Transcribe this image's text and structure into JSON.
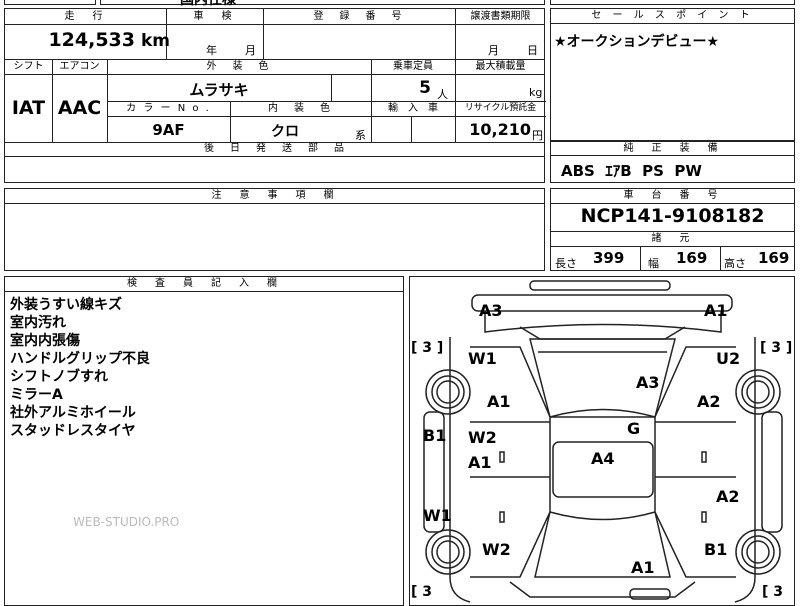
{
  "top_strip": {
    "title": "国内仕様"
  },
  "mileage": {
    "header": "走　行",
    "value": "124,533",
    "unit": "km"
  },
  "inspection": {
    "header": "車　検",
    "year_label": "年",
    "month_label": "月"
  },
  "registration": {
    "header": "登　録　番　号"
  },
  "transfer": {
    "header": "譲渡書類期限",
    "month_label": "月",
    "day_label": "日"
  },
  "vehicle": {
    "shift_label": "シフト",
    "aircon_label": "エアコン",
    "shift": "IAT",
    "aircon": "AAC",
    "exterior_label": "外　装　色",
    "exterior": "ムラサキ",
    "capacity_label": "乗車定員",
    "capacity": "5",
    "capacity_unit": "人",
    "maxload_label": "最大積載量",
    "maxload_unit": "kg",
    "color_no_label": "カ ラ ー N o .",
    "color_no": "9AF",
    "interior_label": "内　装　色",
    "interior": "クロ",
    "interior_suffix": "系",
    "import_label": "輸　入　車",
    "recycle_label": "リサイクル預託金",
    "recycle": "10,210",
    "recycle_unit": "円",
    "later_parts_label": "後　日　発　送　部　品"
  },
  "sales_point": {
    "header": "セ ー ル ス ポ イ ン ト",
    "text": "★オークションデビュー★"
  },
  "equipment": {
    "header": "純　正　装　備",
    "text": "ABS  ｴｱB  PS  PW"
  },
  "caution": {
    "header": "注　意　事　項　欄"
  },
  "chassis": {
    "header": "車　台　番　号",
    "value": "NCP141-9108182"
  },
  "specs": {
    "header": "諸　元",
    "length_label": "長さ",
    "length": "399",
    "width_label": "幅",
    "width": "169",
    "height_label": "高さ",
    "height": "169"
  },
  "inspector": {
    "header": "検　査　員　記　入　欄",
    "notes": [
      "外装うすい線キズ",
      "室内汚れ",
      "室内内張傷",
      "ハンドルグリップ不良",
      "シフトノブすれ",
      "ミラーA",
      "社外アルミホイール",
      "スタッドレスタイヤ"
    ]
  },
  "watermark": "WEB-STUDIO.PRO",
  "diagram": {
    "tire_tl": "[ 3 ]",
    "tire_tr": "[ 3 ]",
    "tire_bl": "[ 3",
    "tire_br": "[ 3",
    "labels": {
      "a3_top": "A3",
      "a1_top": "A1",
      "w1_l": "W1",
      "u2_r": "U2",
      "a3_mid": "A3",
      "a1_lf": "A1",
      "a2_rf": "A2",
      "b1_l": "B1",
      "w2_l": "W2",
      "g": "G",
      "a1_ld": "A1",
      "a4": "A4",
      "a2_rr": "A2",
      "w1_lr": "W1",
      "w2_lr": "W2",
      "b1_rr": "B1",
      "a1_rear": "A1"
    }
  }
}
